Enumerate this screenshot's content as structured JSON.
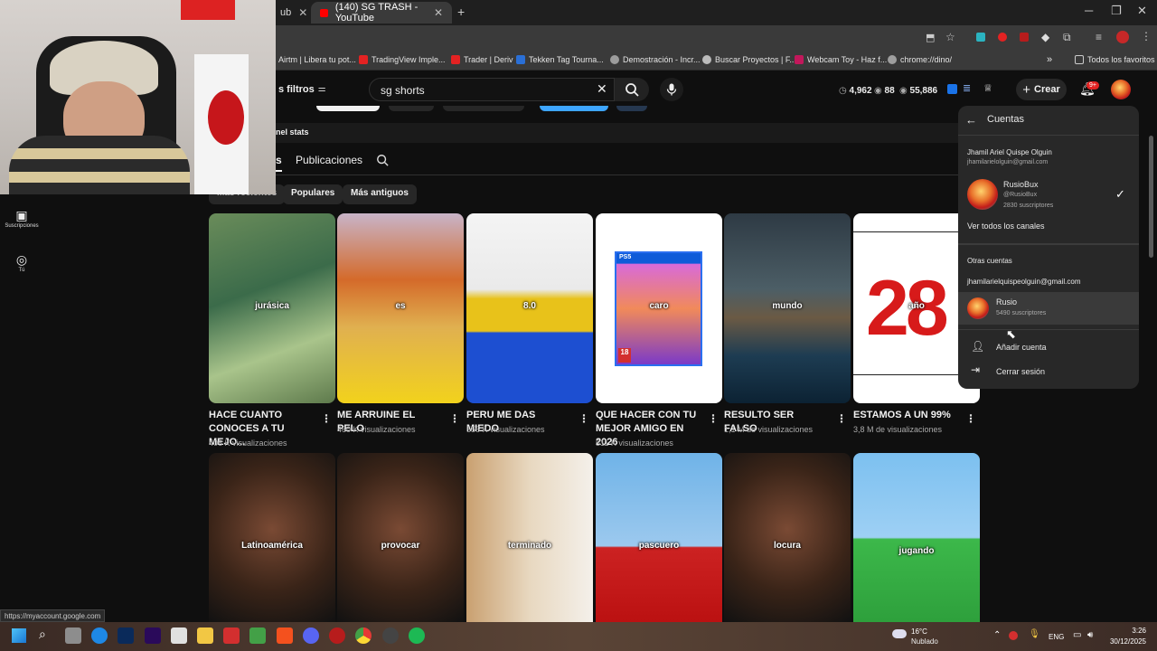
{
  "browser": {
    "tabs": [
      {
        "title": "ub",
        "active": false
      },
      {
        "title": "(140) SG TRASH - YouTube",
        "active": true
      }
    ],
    "bookmarks": [
      {
        "label": "Airtm | Libera tu pot...",
        "color": "#1a73e8"
      },
      {
        "label": "TradingView Imple...",
        "color": "#e32222"
      },
      {
        "label": "Trader | Deriv",
        "color": "#e32222"
      },
      {
        "label": "Tekken Tag Tourna...",
        "color": "#2a6fd6"
      },
      {
        "label": "Demostración - Incr...",
        "color": "#9c9c9c"
      },
      {
        "label": "Buscar Proyectos | F...",
        "color": "#bbbbbb"
      },
      {
        "label": "Webcam Toy - Haz f...",
        "color": "#c2185b"
      },
      {
        "label": "chrome://dino/",
        "color": "#9e9e9e"
      }
    ],
    "all_bookmarks": "Todos los favoritos",
    "status_url": "https://myaccount.google.com"
  },
  "header": {
    "filters_label": "s filtros",
    "search_value": "sg shorts",
    "stats": [
      {
        "icon": "clock-icon",
        "value": "4,962"
      },
      {
        "icon": "eye-icon",
        "value": "88"
      },
      {
        "icon": "eye-icon",
        "value": "55,886"
      }
    ],
    "create_label": "Crear",
    "notifications_badge": "9+"
  },
  "channel": {
    "stats_label": "nel stats",
    "tabs": [
      "s",
      "Publicaciones"
    ],
    "chips": [
      "Más recientes",
      "Populares",
      "Más antiguos"
    ]
  },
  "sidebar": {
    "items": [
      {
        "icon": "subscriptions-icon",
        "label": "Suscripciones"
      },
      {
        "icon": "user-icon",
        "label": "Tú"
      }
    ]
  },
  "videos": [
    {
      "title": "HACE CUANTO CONOCES A TU MEJO...",
      "views": "406 K visualizaciones",
      "overlay": "jurásica",
      "bg": "linear-gradient(160deg,#6a8c5a,#3b6b4a 40%,#a9c48b 70%,#5e7a4c)"
    },
    {
      "title": "ME ARRUINE EL PELO",
      "views": "460 K visualizaciones",
      "overlay": "es",
      "bg": "linear-gradient(180deg,#c8b4c8,#d46a2a 35%,#e0b050 60%,#f2d21c)"
    },
    {
      "title": "PERU ME DAS MIEDO",
      "views": "556 K visualizaciones",
      "overlay": "8.0",
      "bg": "linear-gradient(180deg,#f4f4f4 0,#eaeaea 40%,#e8c21a 45%,#e8c21a 62%,#1d4fd1 63%,#1d4fd1 100%)"
    },
    {
      "title": "QUE HACER CON TU MEJOR AMIGO EN 2026",
      "views": "511 K visualizaciones",
      "overlay": "caro",
      "bg": "#ffffff"
    },
    {
      "title": "RESULTO SER FALSO",
      "views": "1,1 M de visualizaciones",
      "overlay": "mundo",
      "bg": "linear-gradient(180deg,#2e3a44,#4c5e66 40%,#6b5a44 55%,#1d3c52 75%,#0c2233)"
    },
    {
      "title": "ESTAMOS A UN 99%",
      "views": "3,8 M de visualizaciones",
      "overlay": "año",
      "bg": "#ffffff"
    },
    {
      "title": "",
      "views": "",
      "overlay": "Latinoamérica",
      "bg": "radial-gradient(circle at 50% 45%,#7a4a34,#3a2418 55%,#111)"
    },
    {
      "title": "",
      "views": "",
      "overlay": "provocar",
      "bg": "radial-gradient(circle at 50% 45%,#7a4a34,#3a2418 55%,#111)"
    },
    {
      "title": "",
      "views": "",
      "overlay": "terminado",
      "bg": "linear-gradient(90deg,#c9a070,#e8d8c0 50%,#f4f0ea)"
    },
    {
      "title": "",
      "views": "",
      "overlay": "pascuero",
      "bg": "linear-gradient(180deg,#6fb3e8,#9cc9ee 55%,#c22 56%,#b11)"
    },
    {
      "title": "",
      "views": "",
      "overlay": "locura",
      "bg": "radial-gradient(circle at 50% 45%,#7a4a34,#3a2418 55%,#111)"
    },
    {
      "title": "",
      "views": "",
      "overlay": "jugando",
      "bg": "linear-gradient(180deg,#7cc0f0,#9ed0f4 50%,#3cb84a 51%,#2ea03c)"
    }
  ],
  "big_number": "28",
  "ps5_label": "PS5",
  "age_rating": "18",
  "accounts_menu": {
    "title": "Cuentas",
    "owner_name": "Jhamil Ariel Quispe Olguin",
    "owner_email": "jhamilarielolguin@gmail.com",
    "channel_name": "RusioBux",
    "channel_handle": "@RusioBux",
    "channel_subs": "2830 suscriptores",
    "view_all": "Ver todos los canales",
    "other_accounts": "Otras cuentas",
    "other_email": "jhamilarielquispeolguin@gmail.com",
    "other_name": "Rusio",
    "other_subs": "5490 suscriptores",
    "add_account": "Añadir cuenta",
    "sign_out": "Cerrar sesión"
  },
  "taskbar": {
    "temperature": "16°C",
    "weather": "Nublado",
    "language": "ENG",
    "time": "3:26",
    "date": "30/12/2025"
  }
}
